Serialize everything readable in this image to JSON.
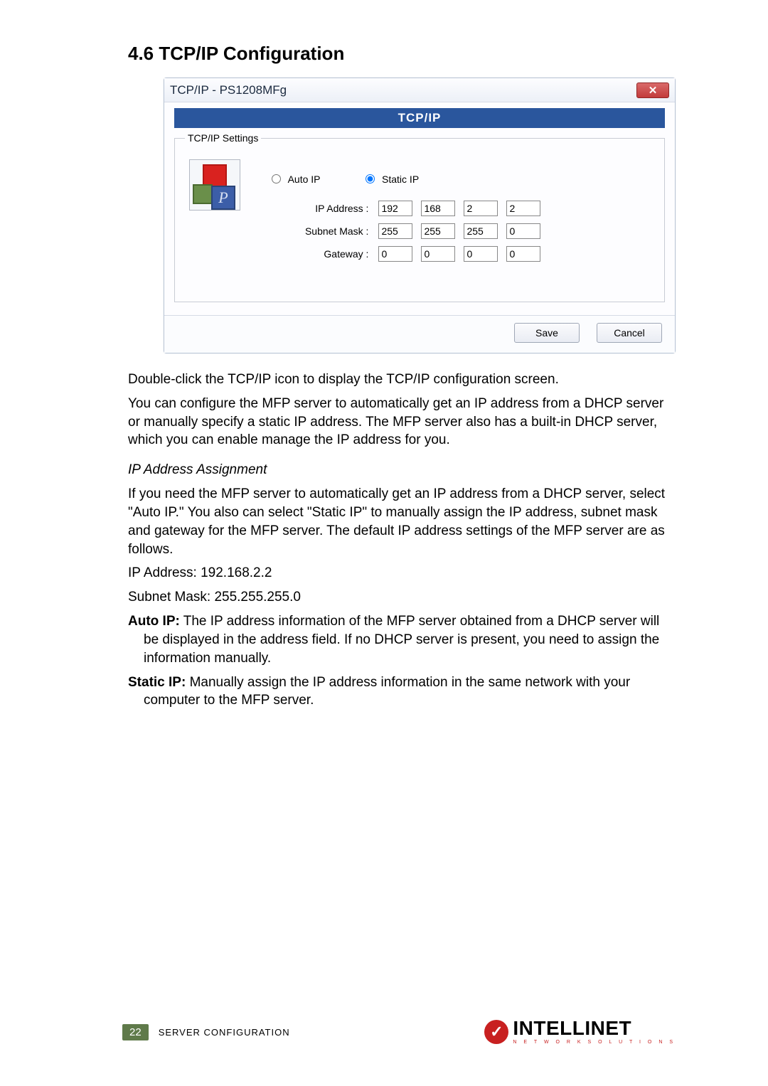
{
  "section_title": "4.6  TCP/IP Configuration",
  "dialog": {
    "title": "TCP/IP - PS1208MFg",
    "close_glyph": "✕",
    "tab_label": "TCP/IP",
    "fieldset_legend": "TCP/IP Settings",
    "icon_letter": "P",
    "radio": {
      "auto": "Auto IP",
      "static": "Static IP"
    },
    "labels": {
      "ip": "IP Address :",
      "mask": "Subnet Mask :",
      "gw": "Gateway :"
    },
    "ip": [
      "192",
      "168",
      "2",
      "2"
    ],
    "mask": [
      "255",
      "255",
      "255",
      "0"
    ],
    "gw": [
      "0",
      "0",
      "0",
      "0"
    ],
    "save": "Save",
    "cancel": "Cancel"
  },
  "body": {
    "p1": "Double-click the TCP/IP icon to display the TCP/IP configuration screen.",
    "p2": "You can configure the MFP server to automatically get an IP address from a DHCP server or manually specify a static IP address. The MFP server also has a built-in DHCP server, which you can enable manage the IP address for you.",
    "heading": "IP Address Assignment",
    "p3": "If you need the MFP server to automatically get an IP address from a DHCP server, select \"Auto IP.\" You also can select \"Static IP\" to manually assign the IP address, subnet mask and gateway for the MFP server. The default IP address settings of the MFP server are as follows.",
    "line_ip": "IP Address: 192.168.2.2",
    "line_mask": "Subnet Mask: 255.255.255.0",
    "auto_label": "Auto IP:",
    "auto_text": " The IP address information of the MFP server obtained from a DHCP server will be displayed in the address field. If no DHCP server is present, you need to assign the information manually.",
    "static_label": "Static IP:",
    "static_text": " Manually assign the IP address information in the same network with your computer to the MFP server."
  },
  "footer": {
    "page": "22",
    "label": "SERVER CONFIGURATION",
    "brand": "INTELLINET",
    "brand_sub": "N E T W O R K   S O L U T I O N S",
    "check": "✓"
  }
}
